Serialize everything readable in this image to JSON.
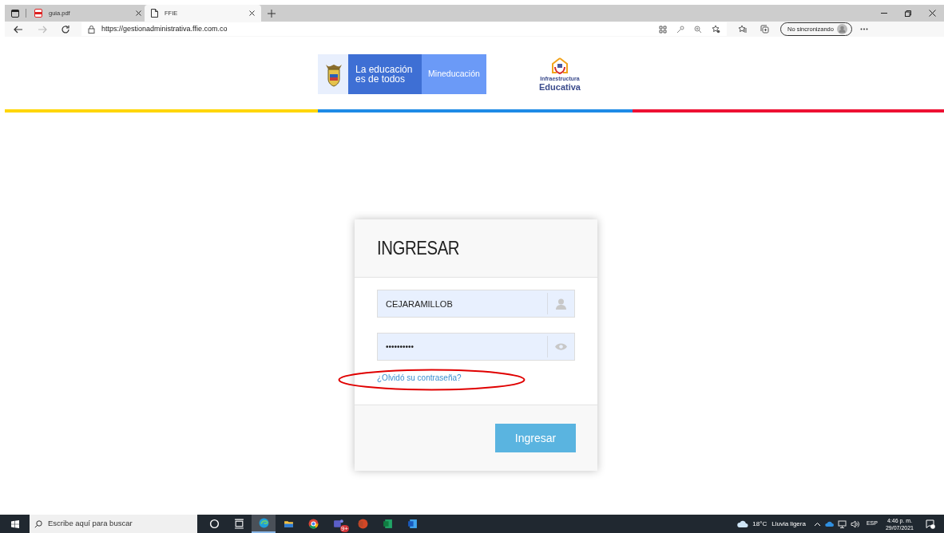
{
  "browser": {
    "tabs": [
      {
        "title": "guia.pdf",
        "kind": "pdf",
        "selected": false
      },
      {
        "title": "FFIE",
        "kind": "page",
        "selected": true
      }
    ],
    "url": "https://gestionadministrativa.ffie.com.co",
    "profile_button": "No sincronizando"
  },
  "header": {
    "slogan": "La educación es de todos",
    "brand": "Mineducación",
    "partner_logo": [
      "Infraestructura",
      "Educativa"
    ]
  },
  "login": {
    "title": "INGRESAR",
    "username": "CEJARAMILLOB",
    "password": "••••••••••",
    "forgot_link": "¿Olvidó su contraseña?",
    "submit_button": "Ingresar"
  },
  "taskbar": {
    "search_placeholder": "Escribe aquí para buscar",
    "apps": [
      {
        "kind": "cortana",
        "selected": false
      },
      {
        "kind": "taskview",
        "selected": false
      },
      {
        "kind": "edge",
        "selected": true
      },
      {
        "kind": "explorer",
        "selected": false
      },
      {
        "kind": "chrome",
        "selected": false
      },
      {
        "kind": "teams",
        "selected": false,
        "badge": "9+"
      },
      {
        "kind": "powerpoint",
        "selected": false
      },
      {
        "kind": "excel",
        "selected": false
      },
      {
        "kind": "word",
        "selected": false
      }
    ],
    "temperature": "18°C",
    "weather": "Lluvia ligera",
    "language": "ESP",
    "time": "4:46 p. m.",
    "date": "29/07/2021"
  }
}
